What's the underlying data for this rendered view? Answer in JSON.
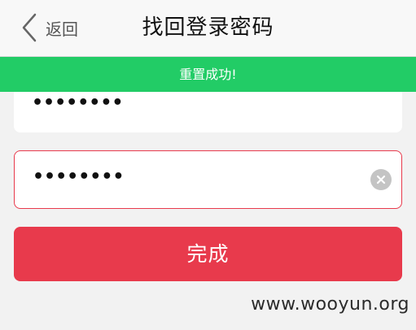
{
  "header": {
    "back_label": "返回",
    "title": "找回登录密码"
  },
  "toast": {
    "message": "重置成功!",
    "color": "#22cc66"
  },
  "form": {
    "new_password_value": "••••••••",
    "confirm_password_value": "••••••••",
    "error_border_color": "#e83a4c"
  },
  "submit_label": "完成",
  "accent_color": "#e83a4c",
  "watermark": "www.wooyun.org"
}
